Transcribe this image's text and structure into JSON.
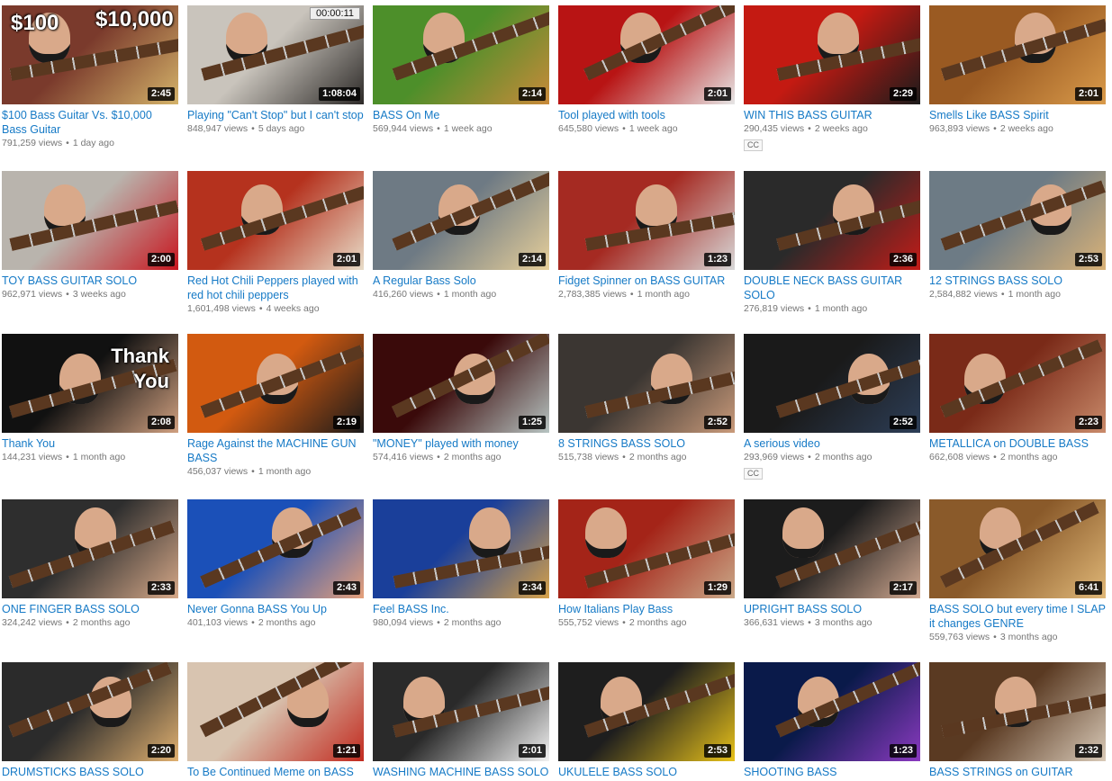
{
  "rows": [
    [
      {
        "title": "$100 Bass Guitar Vs. $10,000 Bass Guitar",
        "views": "791,259 views",
        "age": "1 day ago",
        "duration": "2:45",
        "overlay": [
          "$100",
          "$10,000"
        ],
        "bg": "#7a3a2c",
        "bg2": "#d4b36a",
        "cc": false
      },
      {
        "title": "Playing \"Can't Stop\" but I can't stop",
        "views": "848,947 views",
        "age": "5 days ago",
        "duration": "1:08:04",
        "timer": "00:00:11",
        "bg": "#c9c4bc",
        "bg2": "#2d2a28",
        "cc": false
      },
      {
        "title": "BASS On Me",
        "views": "569,944 views",
        "age": "1 week ago",
        "duration": "2:14",
        "bg": "#4d8f2a",
        "bg2": "#c98a3a",
        "cc": false
      },
      {
        "title": "Tool played with tools",
        "views": "645,580 views",
        "age": "1 week ago",
        "duration": "2:01",
        "bg": "#b81414",
        "bg2": "#e6e6e6",
        "cc": false
      },
      {
        "title": "WIN THIS BASS GUITAR",
        "views": "290,435 views",
        "age": "2 weeks ago",
        "duration": "2:29",
        "bg": "#c41a12",
        "bg2": "#1b1b1b",
        "cc": true
      },
      {
        "title": "Smells Like BASS Spirit",
        "views": "963,893 views",
        "age": "2 weeks ago",
        "duration": "2:01",
        "bg": "#9a5a22",
        "bg2": "#d99a4a",
        "cc": false
      }
    ],
    [
      {
        "title": "TOY BASS GUITAR SOLO",
        "views": "962,971 views",
        "age": "3 weeks ago",
        "duration": "2:00",
        "bg": "#b9b4ad",
        "bg2": "#c8161f",
        "cc": false
      },
      {
        "title": "Red Hot Chili Peppers played with red hot chili peppers",
        "views": "1,601,498 views",
        "age": "4 weeks ago",
        "duration": "2:01",
        "bg": "#b5321e",
        "bg2": "#e8dcc8",
        "cc": false
      },
      {
        "title": "A Regular Bass Solo",
        "views": "416,260 views",
        "age": "1 month ago",
        "duration": "2:14",
        "bg": "#6e7a84",
        "bg2": "#e6cf9a",
        "cc": false
      },
      {
        "title": "Fidget Spinner on BASS GUITAR",
        "views": "2,783,385 views",
        "age": "1 month ago",
        "duration": "1:23",
        "bg": "#a52a22",
        "bg2": "#d8d8d8",
        "cc": false
      },
      {
        "title": "DOUBLE NECK BASS GUITAR SOLO",
        "views": "276,819 views",
        "age": "1 month ago",
        "duration": "2:36",
        "bg": "#2a2a2a",
        "bg2": "#c31c18",
        "cc": false
      },
      {
        "title": "12 STRINGS BASS SOLO",
        "views": "2,584,882 views",
        "age": "1 month ago",
        "duration": "2:53",
        "bg": "#6d7b85",
        "bg2": "#d9b278",
        "cc": false
      }
    ],
    [
      {
        "title": "Thank You",
        "views": "144,231 views",
        "age": "1 month ago",
        "duration": "2:08",
        "overlay": [
          "Thank",
          "You"
        ],
        "bg": "#111111",
        "bg2": "#d0a080",
        "cc": false
      },
      {
        "title": "Rage Against the MACHINE GUN BASS",
        "views": "456,037 views",
        "age": "1 month ago",
        "duration": "2:19",
        "bg": "#d25a10",
        "bg2": "#1a1a1a",
        "cc": false
      },
      {
        "title": "\"MONEY\" played with money",
        "views": "574,416 views",
        "age": "2 months ago",
        "duration": "1:25",
        "bg": "#3a0a0a",
        "bg2": "#b7c4c2",
        "cc": false
      },
      {
        "title": "8 STRINGS BASS SOLO",
        "views": "515,738 views",
        "age": "2 months ago",
        "duration": "2:52",
        "bg": "#3b3632",
        "bg2": "#c99a7a",
        "cc": false
      },
      {
        "title": "A serious video",
        "views": "293,969 views",
        "age": "2 months ago",
        "duration": "2:52",
        "bg": "#1a1a1a",
        "bg2": "#2d3e57",
        "cc": true
      },
      {
        "title": "METALLICA on DOUBLE BASS",
        "views": "662,608 views",
        "age": "2 months ago",
        "duration": "2:23",
        "bg": "#7a2a18",
        "bg2": "#c98a6a",
        "cc": false
      }
    ],
    [
      {
        "title": "ONE FINGER BASS SOLO",
        "views": "324,242 views",
        "age": "2 months ago",
        "duration": "2:33",
        "bg": "#2e2e2e",
        "bg2": "#d6a888",
        "cc": false
      },
      {
        "title": "Never Gonna BASS You Up",
        "views": "401,103 views",
        "age": "2 months ago",
        "duration": "2:43",
        "bg": "#1b50b8",
        "bg2": "#e6a07a",
        "cc": false
      },
      {
        "title": "Feel BASS Inc.",
        "views": "980,094 views",
        "age": "2 months ago",
        "duration": "2:34",
        "bg": "#1a3f9a",
        "bg2": "#d7a24a",
        "cc": false
      },
      {
        "title": "How Italians Play Bass",
        "views": "555,752 views",
        "age": "2 months ago",
        "duration": "1:29",
        "bg": "#a42418",
        "bg2": "#caa888",
        "cc": false
      },
      {
        "title": "UPRIGHT BASS SOLO",
        "views": "366,631 views",
        "age": "3 months ago",
        "duration": "2:17",
        "bg": "#1c1c1c",
        "bg2": "#d0a890",
        "cc": false
      },
      {
        "title": "BASS SOLO but every time I SLAP it changes GENRE",
        "views": "559,763 views",
        "age": "3 months ago",
        "duration": "6:41",
        "bg": "#8a5a2a",
        "bg2": "#e0b878",
        "cc": false
      }
    ],
    [
      {
        "title": "DRUMSTICKS BASS SOLO",
        "views": "",
        "age": "",
        "duration": "2:20",
        "bg": "#2b2b2b",
        "bg2": "#e0b070",
        "cc": false
      },
      {
        "title": "To Be Continued Meme on BASS",
        "views": "",
        "age": "",
        "duration": "1:21",
        "bg": "#d8c4b0",
        "bg2": "#c22a1f",
        "cc": false
      },
      {
        "title": "WASHING MACHINE BASS SOLO",
        "views": "",
        "age": "",
        "duration": "2:01",
        "bg": "#2a2a2a",
        "bg2": "#f2f2f2",
        "cc": false
      },
      {
        "title": "UKULELE BASS SOLO",
        "views": "",
        "age": "",
        "duration": "2:53",
        "bg": "#1e1e1e",
        "bg2": "#e8c21a",
        "cc": false
      },
      {
        "title": "SHOOTING BASS",
        "views": "",
        "age": "",
        "duration": "1:23",
        "bg": "#0a1a4a",
        "bg2": "#8a3ac0",
        "cc": false
      },
      {
        "title": "BASS STRINGS on GUITAR",
        "views": "",
        "age": "",
        "duration": "2:32",
        "bg": "#5a3a22",
        "bg2": "#d9cab8",
        "cc": false
      }
    ]
  ],
  "cc_label": "CC",
  "dot": "•"
}
